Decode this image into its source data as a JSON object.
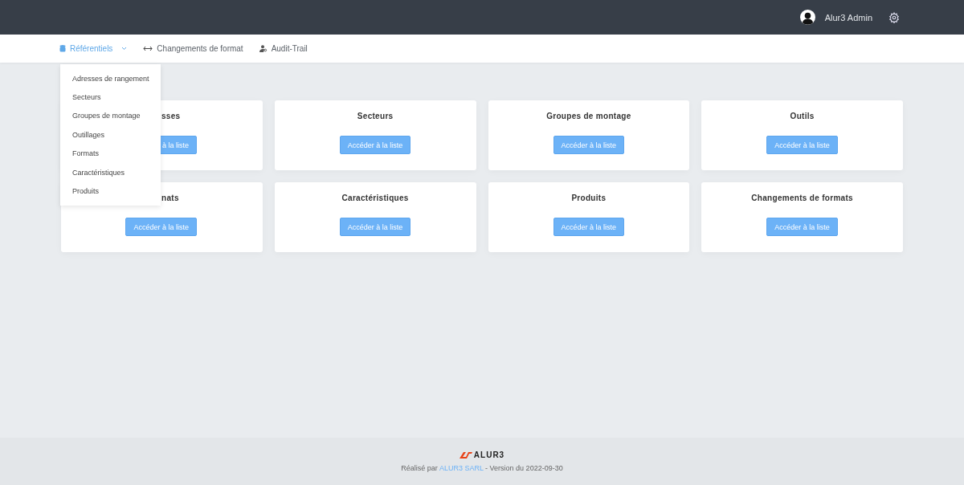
{
  "header": {
    "user": "Alur3 Admin"
  },
  "nav": [
    {
      "label": "Référentiels",
      "kind": "dropdown",
      "selected": true
    },
    {
      "label": "Changements de format",
      "kind": "arrows",
      "selected": false
    },
    {
      "label": "Audit-Trail",
      "kind": "user",
      "selected": false
    }
  ],
  "dropdown": {
    "expanded": true,
    "items": [
      "Adresses de rangement",
      "Secteurs",
      "Groupes de montage",
      "Outillages",
      "Formats",
      "Caractéristiques",
      "Produits"
    ]
  },
  "cards": [
    {
      "title": "sses",
      "covered": true,
      "button": "à la liste"
    },
    {
      "title": "Secteurs",
      "covered": false,
      "button": "Accéder à la liste"
    },
    {
      "title": "Groupes de montage",
      "covered": false,
      "button": "Accéder à la liste"
    },
    {
      "title": "Outils",
      "covered": false,
      "button": "Accéder à la liste"
    },
    {
      "title": "nats",
      "covered": true,
      "button": "Accéder à la liste"
    },
    {
      "title": "Caractéristiques",
      "covered": false,
      "button": "Accéder à la liste"
    },
    {
      "title": "Produits",
      "covered": false,
      "button": "Accéder à la liste"
    },
    {
      "title": "Changements de formats",
      "covered": false,
      "button": "Accéder à la liste"
    }
  ],
  "footer": {
    "logo": "ALUR3",
    "prefix": "Réalisé par",
    "link": "ALUR3 SARL",
    "suffix": "- Version du 2022-09-30"
  }
}
